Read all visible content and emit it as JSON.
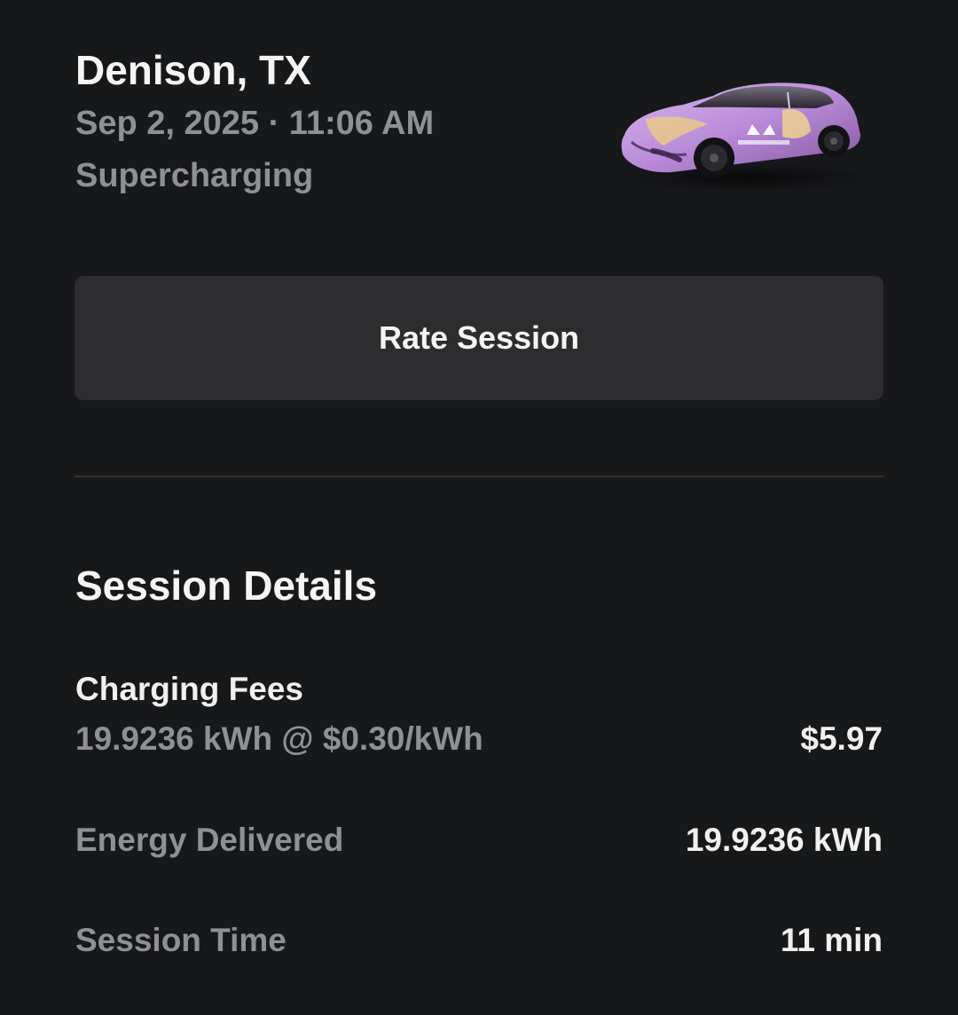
{
  "header": {
    "location": "Denison, TX",
    "datetime": "Sep 2, 2025 · 11:06 AM",
    "session_type": "Supercharging",
    "vehicle_image_icon": "car-wrap-image"
  },
  "actions": {
    "rate_session_label": "Rate Session"
  },
  "details": {
    "heading": "Session Details",
    "charging_fees": {
      "label": "Charging Fees",
      "detail": "19.9236 kWh @ $0.30/kWh",
      "amount": "$5.97"
    },
    "energy_delivered": {
      "label": "Energy Delivered",
      "value": "19.9236 kWh"
    },
    "session_time": {
      "label": "Session Time",
      "value": "11 min"
    }
  },
  "colors": {
    "background": "#17181a",
    "button": "#2d2d2f",
    "primary_text": "#f5f5f5",
    "secondary_text": "#8f9093",
    "divider": "#34302d"
  }
}
